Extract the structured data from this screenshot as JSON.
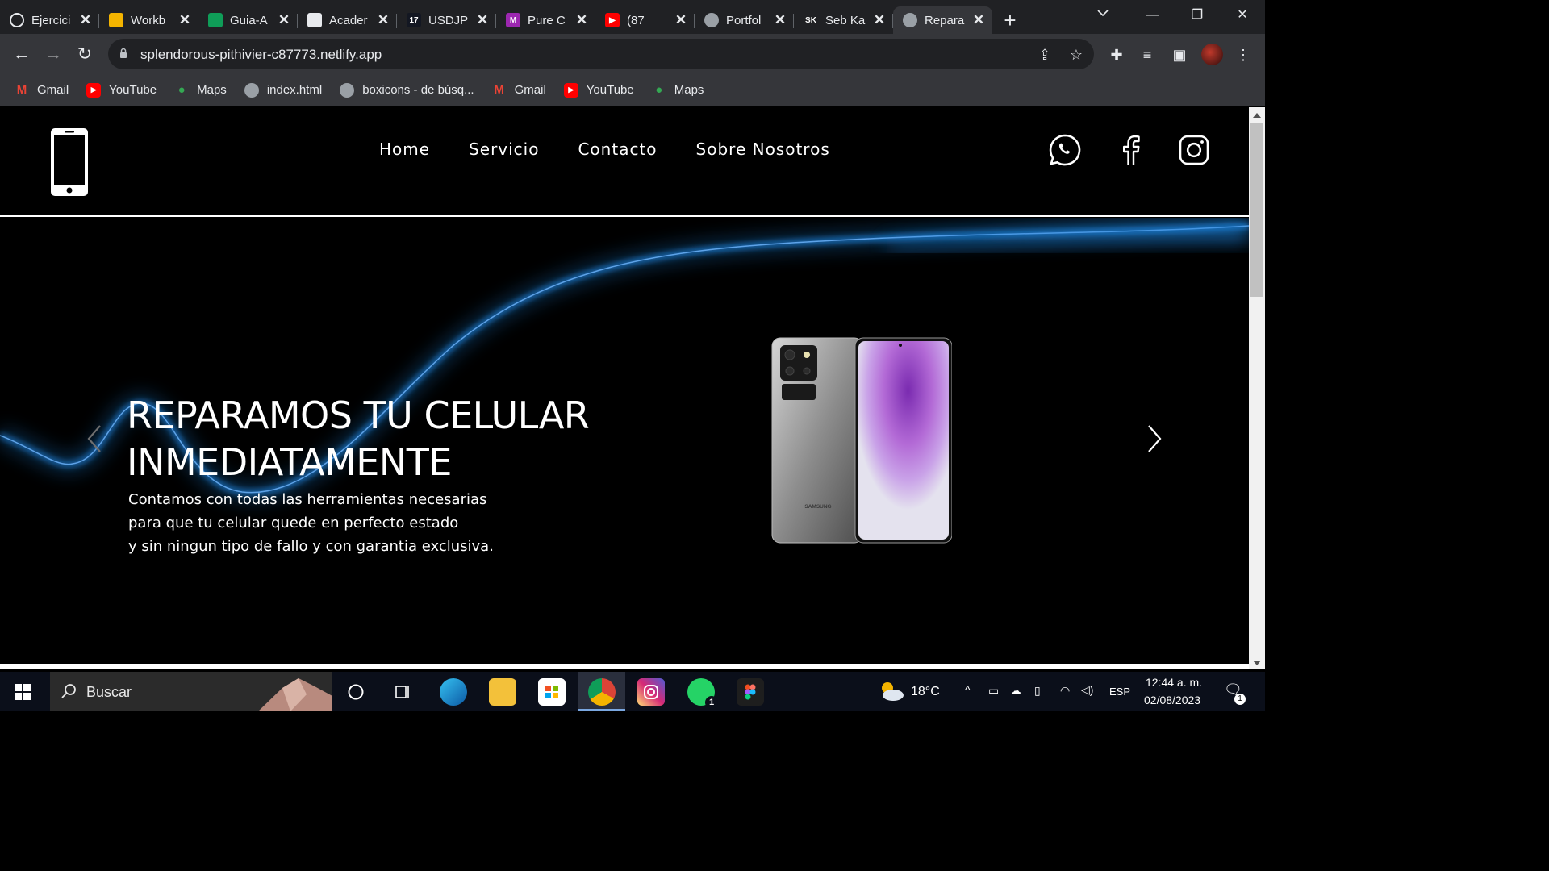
{
  "browser": {
    "tabs": [
      {
        "label": "Ejercici",
        "icon": "github-icon",
        "color": "#202124",
        "active": false
      },
      {
        "label": "Workb",
        "icon": "slides-icon",
        "color": "#f4b400",
        "active": false
      },
      {
        "label": "Guia-A",
        "icon": "drive-icon",
        "color": "#0f9d58",
        "active": false
      },
      {
        "label": "Acader",
        "icon": "academy-icon",
        "color": "#e8eaed",
        "active": false
      },
      {
        "label": "USDJP",
        "icon": "tradingview-icon",
        "color": "#131722",
        "active": false
      },
      {
        "label": "Pure C",
        "icon": "pure-icon",
        "color": "#9c27b0",
        "active": false
      },
      {
        "label": "(87",
        "icon": "youtube-icon",
        "color": "#ff0000",
        "active": false
      },
      {
        "label": "Portfol",
        "icon": "globe-icon",
        "color": "#5f6368",
        "active": false
      },
      {
        "label": "Seb Ka",
        "icon": "sk-icon",
        "color": "#202124",
        "active": false
      },
      {
        "label": "Repara",
        "icon": "globe-icon",
        "color": "#5f6368",
        "active": true
      }
    ],
    "favicon_text": {
      "tradingview": "17",
      "pure": "M",
      "sk": "SK"
    },
    "url": "splendorous-pithivier-c87773.netlify.app",
    "bookmarks": [
      {
        "label": "Gmail",
        "icon": "gmail-icon"
      },
      {
        "label": "YouTube",
        "icon": "youtube-icon"
      },
      {
        "label": "Maps",
        "icon": "maps-icon"
      },
      {
        "label": "index.html",
        "icon": "globe-icon"
      },
      {
        "label": "boxicons - de búsq...",
        "icon": "globe-icon"
      },
      {
        "label": "Gmail",
        "icon": "gmail-icon"
      },
      {
        "label": "YouTube",
        "icon": "youtube-icon"
      },
      {
        "label": "Maps",
        "icon": "maps-icon"
      }
    ]
  },
  "site": {
    "nav": [
      "Home",
      "Servicio",
      "Contacto",
      "Sobre Nosotros"
    ],
    "social": [
      "whatsapp-icon",
      "facebook-icon",
      "instagram-icon"
    ],
    "hero": {
      "title_line1": "REPARAMOS TU CELULAR",
      "title_line2": "INMEDIATAMENTE",
      "text_line1": "Contamos con todas las herramientas necesarias",
      "text_line2": "para que tu celular quede en perfecto estado",
      "text_line3": "y sin ningun tipo de fallo y con garantia exclusiva.",
      "phone_brand": "SAMSUNG"
    },
    "colors": {
      "accent_wave": "#1e7fd6",
      "whatsapp": "#25d366"
    }
  },
  "taskbar": {
    "search_placeholder": "Buscar",
    "weather": "18°C",
    "language": "ESP",
    "time": "12:44 a. m.",
    "date": "02/08/2023",
    "notification_count": "1",
    "whatsapp_badge": "1"
  }
}
